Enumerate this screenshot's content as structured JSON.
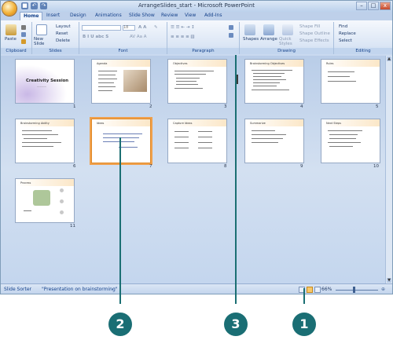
{
  "window": {
    "title": "ArrangeSlides_start - Microsoft PowerPoint",
    "controls": [
      "–",
      "□",
      "x"
    ]
  },
  "tabs": [
    "Home",
    "Insert",
    "Design",
    "Animations",
    "Slide Show",
    "Review",
    "View",
    "Add-Ins"
  ],
  "ribbon": {
    "clipboard": {
      "label": "Clipboard",
      "paste": "Paste"
    },
    "slides": {
      "label": "Slides",
      "new_slide": "New Slide",
      "layout": "Layout",
      "reset": "Reset",
      "delete": "Delete"
    },
    "font": {
      "label": "Font",
      "size": "18"
    },
    "paragraph": {
      "label": "Paragraph"
    },
    "drawing": {
      "label": "Drawing",
      "shapes": "Shapes",
      "arrange": "Arrange",
      "quick_styles": "Quick Styles",
      "shape_fill": "Shape Fill",
      "shape_outline": "Shape Outline",
      "shape_effects": "Shape Effects"
    },
    "editing": {
      "label": "Editing",
      "find": "Find",
      "replace": "Replace",
      "select": "Select"
    }
  },
  "slides": [
    {
      "num": "1",
      "title": "Creativity Session"
    },
    {
      "num": "2",
      "title": "Agenda"
    },
    {
      "num": "3",
      "title": "Objectives"
    },
    {
      "num": "4",
      "title": "Brainstorming Objectives"
    },
    {
      "num": "5",
      "title": "Rules"
    },
    {
      "num": "6",
      "title": "Brainstorming Ability"
    },
    {
      "num": "7",
      "title": "Ideas"
    },
    {
      "num": "8",
      "title": "Capture Ideas"
    },
    {
      "num": "9",
      "title": "Summarize"
    },
    {
      "num": "10",
      "title": "Next Steps"
    },
    {
      "num": "11",
      "title": "Process"
    }
  ],
  "status": {
    "view": "Slide Sorter",
    "theme": "\"Presentation on brainstorming\"",
    "zoom": "66%"
  },
  "callouts": [
    "2",
    "3",
    "1"
  ]
}
